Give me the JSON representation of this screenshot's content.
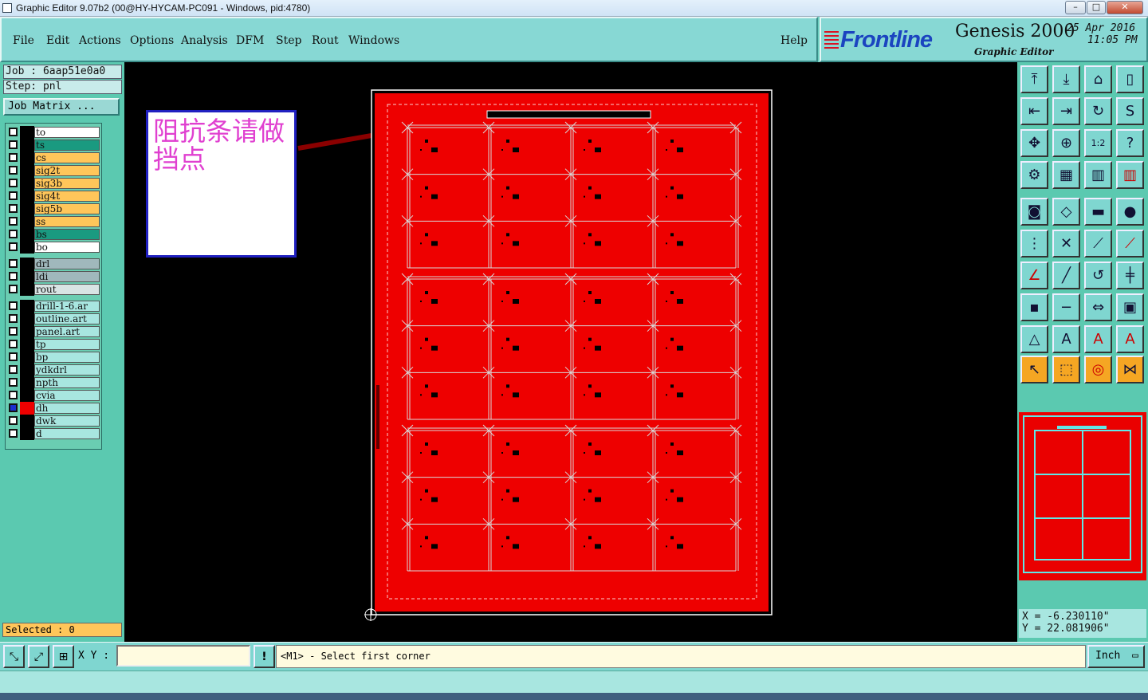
{
  "window": {
    "title": "Graphic Editor 9.07b2 (00@HY-HYCAM-PC091 - Windows, pid:4780)",
    "controls": [
      "–",
      "□",
      "✕"
    ]
  },
  "menu": {
    "items": [
      "File",
      "Edit",
      "Actions",
      "Options",
      "Analysis",
      "DFM",
      "Step",
      "Rout",
      "Windows"
    ],
    "help": "Help"
  },
  "brand": {
    "logo": "Frontline",
    "product": "Genesis 2000",
    "subtitle": "Graphic Editor",
    "date": "25 Apr 2016",
    "time": "11:05 PM"
  },
  "job": {
    "job_label": "Job : 6aap51e0a0",
    "step_label": "Step: pnl",
    "matrix_button": "Job Matrix ..."
  },
  "layers": {
    "group1": [
      {
        "name": "to",
        "color": "#ffffff"
      },
      {
        "name": "ts",
        "color": "#1a9a80"
      },
      {
        "name": "cs",
        "color": "#ffc65a"
      },
      {
        "name": "sig2t",
        "color": "#ffc65a"
      },
      {
        "name": "sig3b",
        "color": "#ffc65a"
      },
      {
        "name": "sig4t",
        "color": "#ffc65a"
      },
      {
        "name": "sig5b",
        "color": "#ffc65a"
      },
      {
        "name": "ss",
        "color": "#ffc65a"
      },
      {
        "name": "bs",
        "color": "#1a9a80"
      },
      {
        "name": "bo",
        "color": "#ffffff"
      }
    ],
    "group2": [
      {
        "name": "drl",
        "color": "#a0b8bc"
      },
      {
        "name": "ldi",
        "color": "#a0b8bc"
      },
      {
        "name": "rout",
        "color": "#d8e4e4"
      }
    ],
    "group3": [
      {
        "name": "drill-1-6.ar",
        "color": "#a8e6e0"
      },
      {
        "name": "outline.art",
        "color": "#a8e6e0"
      },
      {
        "name": "panel.art",
        "color": "#a8e6e0"
      },
      {
        "name": "tp",
        "color": "#a8e6e0"
      },
      {
        "name": "bp",
        "color": "#a8e6e0"
      },
      {
        "name": "ydkdrl",
        "color": "#a8e6e0"
      },
      {
        "name": "npth",
        "color": "#a8e6e0"
      },
      {
        "name": "cvia",
        "color": "#a8e6e0"
      },
      {
        "name": "dh",
        "color": "#a8e6e0"
      },
      {
        "name": "dwk",
        "color": "#a8e6e0"
      },
      {
        "name": "d",
        "color": "#a8e6e0"
      }
    ]
  },
  "selected": "Selected : 0",
  "annotation": "阻抗条请做挡点",
  "coords": {
    "x": "X = -6.230110\"",
    "y": "Y = 22.081906\""
  },
  "bottom": {
    "xy_label": "X Y :",
    "xy_value": "",
    "prompt": "<M1> - Select first corner",
    "unit": "Inch"
  },
  "colors": {
    "board": "#ee0000",
    "accent": "#5bc9b0",
    "highlight": "#ffc65a"
  }
}
